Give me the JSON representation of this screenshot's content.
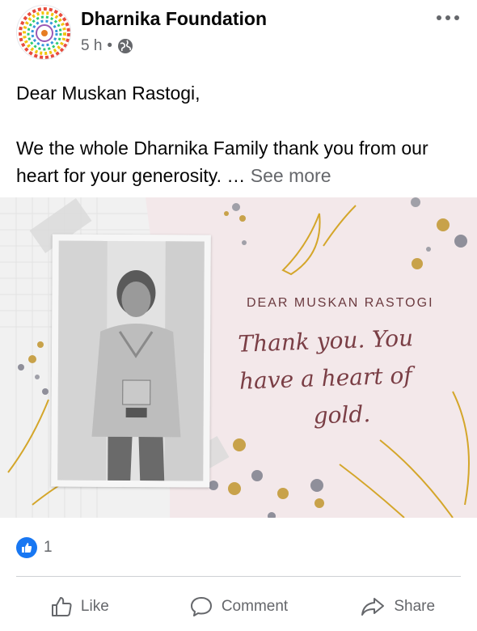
{
  "post": {
    "page_name": "Dharnika Foundation",
    "time": "5 h",
    "separator": "•",
    "privacy_icon": "globe-icon",
    "greeting": "Dear Muskan Rastogi,",
    "body": "We the whole Dharnika Family thank you from our heart for your generosity. …",
    "see_more": "See more"
  },
  "card": {
    "heading": "DEAR MUSKAN RASTOGI",
    "script_line1": "Thank you. You",
    "script_line2": "have a heart of",
    "script_line3": "gold."
  },
  "reactions": {
    "icon": "thumbs-up-icon",
    "count": "1"
  },
  "actions": {
    "like": "Like",
    "comment": "Comment",
    "share": "Share"
  },
  "colors": {
    "brand": "#1877f2",
    "secondary_text": "#65676b",
    "card_background": "#f3e8ea",
    "gold": "#d4a62a",
    "script": "#7a3e45"
  }
}
